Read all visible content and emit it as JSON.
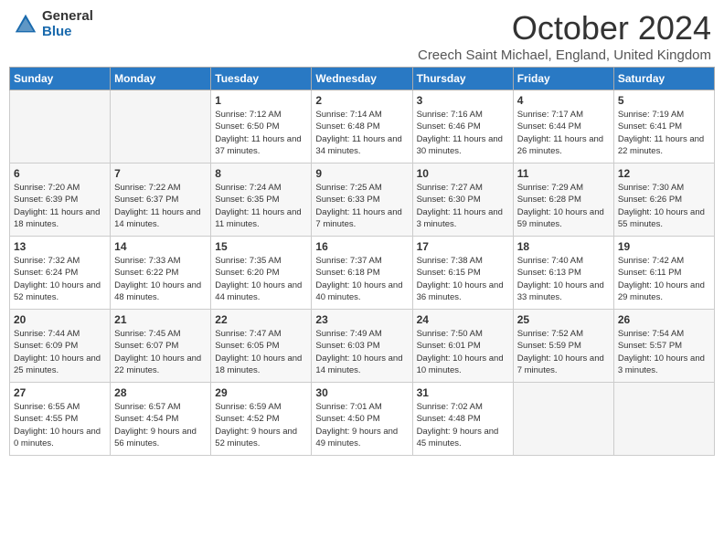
{
  "header": {
    "logo_general": "General",
    "logo_blue": "Blue",
    "month_title": "October 2024",
    "location": "Creech Saint Michael, England, United Kingdom"
  },
  "weekdays": [
    "Sunday",
    "Monday",
    "Tuesday",
    "Wednesday",
    "Thursday",
    "Friday",
    "Saturday"
  ],
  "weeks": [
    [
      {
        "day": "",
        "info": ""
      },
      {
        "day": "",
        "info": ""
      },
      {
        "day": "1",
        "info": "Sunrise: 7:12 AM\nSunset: 6:50 PM\nDaylight: 11 hours and 37 minutes."
      },
      {
        "day": "2",
        "info": "Sunrise: 7:14 AM\nSunset: 6:48 PM\nDaylight: 11 hours and 34 minutes."
      },
      {
        "day": "3",
        "info": "Sunrise: 7:16 AM\nSunset: 6:46 PM\nDaylight: 11 hours and 30 minutes."
      },
      {
        "day": "4",
        "info": "Sunrise: 7:17 AM\nSunset: 6:44 PM\nDaylight: 11 hours and 26 minutes."
      },
      {
        "day": "5",
        "info": "Sunrise: 7:19 AM\nSunset: 6:41 PM\nDaylight: 11 hours and 22 minutes."
      }
    ],
    [
      {
        "day": "6",
        "info": "Sunrise: 7:20 AM\nSunset: 6:39 PM\nDaylight: 11 hours and 18 minutes."
      },
      {
        "day": "7",
        "info": "Sunrise: 7:22 AM\nSunset: 6:37 PM\nDaylight: 11 hours and 14 minutes."
      },
      {
        "day": "8",
        "info": "Sunrise: 7:24 AM\nSunset: 6:35 PM\nDaylight: 11 hours and 11 minutes."
      },
      {
        "day": "9",
        "info": "Sunrise: 7:25 AM\nSunset: 6:33 PM\nDaylight: 11 hours and 7 minutes."
      },
      {
        "day": "10",
        "info": "Sunrise: 7:27 AM\nSunset: 6:30 PM\nDaylight: 11 hours and 3 minutes."
      },
      {
        "day": "11",
        "info": "Sunrise: 7:29 AM\nSunset: 6:28 PM\nDaylight: 10 hours and 59 minutes."
      },
      {
        "day": "12",
        "info": "Sunrise: 7:30 AM\nSunset: 6:26 PM\nDaylight: 10 hours and 55 minutes."
      }
    ],
    [
      {
        "day": "13",
        "info": "Sunrise: 7:32 AM\nSunset: 6:24 PM\nDaylight: 10 hours and 52 minutes."
      },
      {
        "day": "14",
        "info": "Sunrise: 7:33 AM\nSunset: 6:22 PM\nDaylight: 10 hours and 48 minutes."
      },
      {
        "day": "15",
        "info": "Sunrise: 7:35 AM\nSunset: 6:20 PM\nDaylight: 10 hours and 44 minutes."
      },
      {
        "day": "16",
        "info": "Sunrise: 7:37 AM\nSunset: 6:18 PM\nDaylight: 10 hours and 40 minutes."
      },
      {
        "day": "17",
        "info": "Sunrise: 7:38 AM\nSunset: 6:15 PM\nDaylight: 10 hours and 36 minutes."
      },
      {
        "day": "18",
        "info": "Sunrise: 7:40 AM\nSunset: 6:13 PM\nDaylight: 10 hours and 33 minutes."
      },
      {
        "day": "19",
        "info": "Sunrise: 7:42 AM\nSunset: 6:11 PM\nDaylight: 10 hours and 29 minutes."
      }
    ],
    [
      {
        "day": "20",
        "info": "Sunrise: 7:44 AM\nSunset: 6:09 PM\nDaylight: 10 hours and 25 minutes."
      },
      {
        "day": "21",
        "info": "Sunrise: 7:45 AM\nSunset: 6:07 PM\nDaylight: 10 hours and 22 minutes."
      },
      {
        "day": "22",
        "info": "Sunrise: 7:47 AM\nSunset: 6:05 PM\nDaylight: 10 hours and 18 minutes."
      },
      {
        "day": "23",
        "info": "Sunrise: 7:49 AM\nSunset: 6:03 PM\nDaylight: 10 hours and 14 minutes."
      },
      {
        "day": "24",
        "info": "Sunrise: 7:50 AM\nSunset: 6:01 PM\nDaylight: 10 hours and 10 minutes."
      },
      {
        "day": "25",
        "info": "Sunrise: 7:52 AM\nSunset: 5:59 PM\nDaylight: 10 hours and 7 minutes."
      },
      {
        "day": "26",
        "info": "Sunrise: 7:54 AM\nSunset: 5:57 PM\nDaylight: 10 hours and 3 minutes."
      }
    ],
    [
      {
        "day": "27",
        "info": "Sunrise: 6:55 AM\nSunset: 4:55 PM\nDaylight: 10 hours and 0 minutes."
      },
      {
        "day": "28",
        "info": "Sunrise: 6:57 AM\nSunset: 4:54 PM\nDaylight: 9 hours and 56 minutes."
      },
      {
        "day": "29",
        "info": "Sunrise: 6:59 AM\nSunset: 4:52 PM\nDaylight: 9 hours and 52 minutes."
      },
      {
        "day": "30",
        "info": "Sunrise: 7:01 AM\nSunset: 4:50 PM\nDaylight: 9 hours and 49 minutes."
      },
      {
        "day": "31",
        "info": "Sunrise: 7:02 AM\nSunset: 4:48 PM\nDaylight: 9 hours and 45 minutes."
      },
      {
        "day": "",
        "info": ""
      },
      {
        "day": "",
        "info": ""
      }
    ]
  ]
}
